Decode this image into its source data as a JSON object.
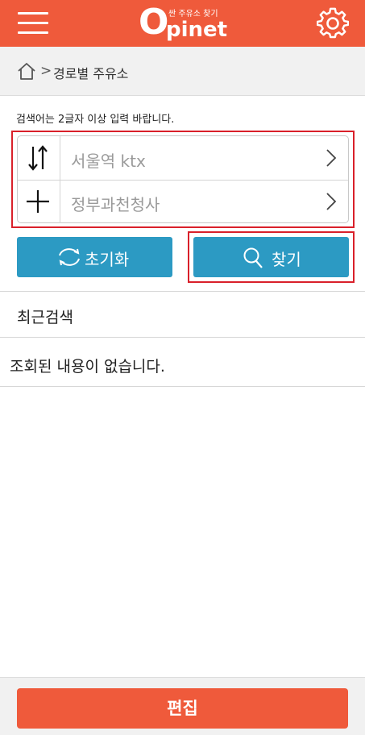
{
  "header": {
    "logo_subtitle": "싼 주유소 찾기",
    "logo_o": "O",
    "logo_rest": "pinet",
    "color": "#ef5a3b",
    "menu_icon": "hamburger-menu-icon",
    "settings_icon": "gear-icon"
  },
  "breadcrumb": {
    "home_icon": "home-icon",
    "separator": ">",
    "current": "경로별 주유소"
  },
  "search": {
    "hint": "검색어는 2글자 이상 입력 바랍니다.",
    "origin": "서울역 ktx",
    "destination": "정부과천청사",
    "swap_icon": "swap-arrows-icon",
    "add_icon": "plus-icon"
  },
  "buttons": {
    "reset_label": "초기화",
    "search_label": "찾기",
    "color": "#2c9ac3"
  },
  "recent": {
    "title": "최근검색",
    "empty_message": "조회된 내용이 없습니다."
  },
  "footer": {
    "edit_label": "편집"
  }
}
